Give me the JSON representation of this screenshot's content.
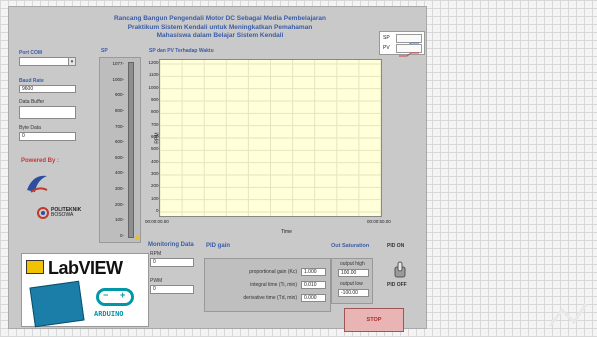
{
  "app": {
    "title_line1": "Rancang Bangun Pengendali Motor DC Sebagai Media Pembelajaran",
    "title_line2": "Praktikum Sistem Kendali untuk Meningkatkan Pemahaman",
    "title_line3": "Mahasiswa dalam Belajar Sistem Kendali"
  },
  "left": {
    "port_com_label": "Port COM",
    "port_com_value": "",
    "baud_rate_label": "Baud Rate",
    "baud_rate_value": "9600",
    "data_buffer_label": "Data Buffer",
    "data_buffer_value": "",
    "byte_data_label": "Byte Data",
    "byte_data_value": "0",
    "powered_by_label": "Powered By :",
    "politeknik_text": "POLITEKNIK",
    "politeknik_sub": "BOSOWA"
  },
  "sp_gauge": {
    "label": "SP",
    "ticks": [
      "1077-",
      "1000-",
      "900-",
      "800-",
      "700-",
      "600-",
      "500-",
      "400-",
      "300-",
      "200-",
      "100-",
      "0-"
    ],
    "value": 0
  },
  "chart": {
    "title": "SP dan PV Terhadap Waktu",
    "ylabel": "RPM",
    "xlabel": "Time",
    "x_start": "00:00:00.00",
    "x_end": "00:00:50.00",
    "legend_sp": "SP",
    "legend_pv": "PV"
  },
  "chart_data": {
    "type": "line",
    "title": "SP dan PV Terhadap Waktu",
    "xlabel": "Time",
    "ylabel": "RPM",
    "y_ticks": [
      "1200-",
      "1100-",
      "1000-",
      "900-",
      "800-",
      "700-",
      "600-",
      "500-",
      "400-",
      "300-",
      "200-",
      "100-",
      "0-"
    ],
    "ylim": [
      0,
      1200
    ],
    "x_tick_labels": [
      "00:00:00.00",
      "00:00:50.00"
    ],
    "series": [
      {
        "name": "SP",
        "values": []
      },
      {
        "name": "PV",
        "values": []
      }
    ],
    "grid": true,
    "legend_position": "top-right"
  },
  "monitoring": {
    "title": "Monitoring Data",
    "rpm_label": "RPM",
    "rpm_value": "0",
    "pwm_label": "PWM",
    "pwm_value": "0"
  },
  "pid": {
    "title": "PID gain",
    "kc_label": "proportional gain (Kc)",
    "kc_value": "1.000",
    "ti_label": "integral time (Ti, min)",
    "ti_value": "0.010",
    "td_label": "derivative time (Td, min)",
    "td_value": "0.000"
  },
  "saturation": {
    "title": "Out Saturation",
    "high_label": "output high",
    "high_value": "100.00",
    "low_label": "output low",
    "low_value": "-100.00"
  },
  "pid_switch": {
    "on_label": "PID ON",
    "off_label": "PID OFF"
  },
  "stop_button": {
    "label": "STOP"
  },
  "logos": {
    "labview_text": "LabVIEW",
    "arduino_text": "ARDUINO"
  },
  "colors": {
    "accent_blue": "#3a5da8",
    "plot_bg": "#ffffd9",
    "stop_red": "#b02a2a"
  }
}
